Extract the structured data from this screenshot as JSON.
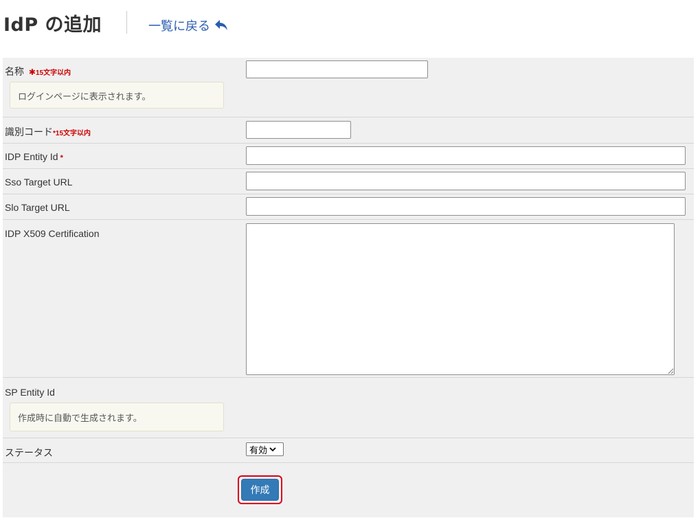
{
  "header": {
    "title": "IdP の追加",
    "back_label": "一覧に戻る"
  },
  "form": {
    "name": {
      "label": "名称",
      "required_mark": "✱",
      "constraint": "15文字以内",
      "value": "",
      "note": "ログインページに表示されます。"
    },
    "code": {
      "label": "識別コード",
      "constraint": "*15文字以内",
      "value": ""
    },
    "idp_entity_id": {
      "label": "IDP Entity Id",
      "required_mark": "*",
      "value": ""
    },
    "sso_target_url": {
      "label": "Sso Target URL",
      "value": ""
    },
    "slo_target_url": {
      "label": "Slo Target URL",
      "value": ""
    },
    "idp_x509": {
      "label": "IDP X509 Certification",
      "value": ""
    },
    "sp_entity_id": {
      "label": "SP Entity Id",
      "note": "作成時に自動で生成されます。"
    },
    "status": {
      "label": "ステータス",
      "selected": "有効"
    },
    "submit_label": "作成"
  },
  "colors": {
    "accent": "#337ab7",
    "highlight": "#d9001b",
    "link": "#2a5db0",
    "required": "#cc0000"
  },
  "icons": {
    "back": "reply-arrow-icon",
    "select": "chevron-down-icon"
  }
}
